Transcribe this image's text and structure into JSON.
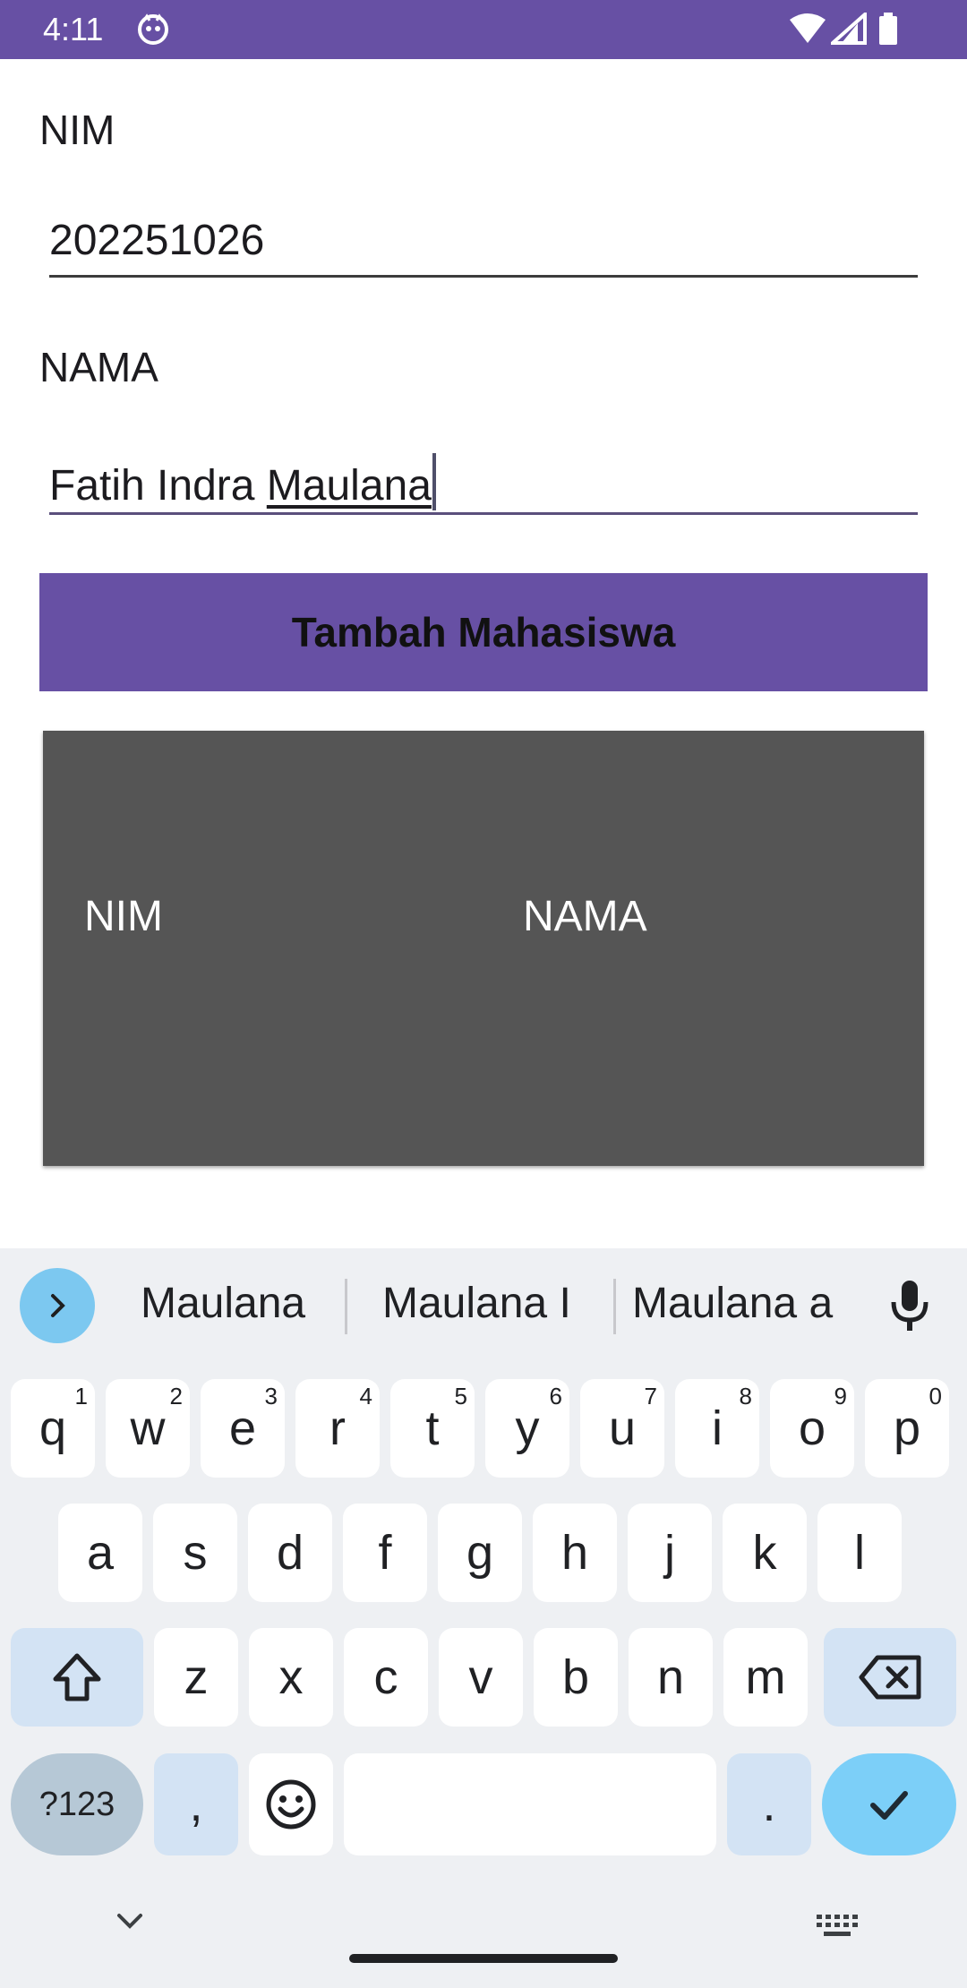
{
  "status_bar": {
    "time": "4:11"
  },
  "form": {
    "nim_label": "NIM",
    "nim_value": "202251026",
    "nama_label": "NAMA",
    "nama_value_prefix": "Fatih Indra ",
    "nama_value_composing": "Maulana",
    "add_button_label": "Tambah Mahasiswa"
  },
  "table": {
    "headers": [
      "NIM",
      "NAMA"
    ]
  },
  "keyboard": {
    "suggestions": [
      "Maulana",
      "Maulana I",
      "Maulana a"
    ],
    "row1": [
      {
        "key": "q",
        "hint": "1"
      },
      {
        "key": "w",
        "hint": "2"
      },
      {
        "key": "e",
        "hint": "3"
      },
      {
        "key": "r",
        "hint": "4"
      },
      {
        "key": "t",
        "hint": "5"
      },
      {
        "key": "y",
        "hint": "6"
      },
      {
        "key": "u",
        "hint": "7"
      },
      {
        "key": "i",
        "hint": "8"
      },
      {
        "key": "o",
        "hint": "9"
      },
      {
        "key": "p",
        "hint": "0"
      }
    ],
    "row2": [
      "a",
      "s",
      "d",
      "f",
      "g",
      "h",
      "j",
      "k",
      "l"
    ],
    "row3": [
      "z",
      "x",
      "c",
      "v",
      "b",
      "n",
      "m"
    ],
    "symbols_label": "?123",
    "comma_label": ",",
    "period_label": ".",
    "icons": {
      "expand": "chevron-right-icon",
      "mic": "microphone-icon",
      "shift": "shift-icon",
      "backspace": "backspace-icon",
      "emoji": "emoji-icon",
      "enter": "checkmark-icon",
      "hide": "chevron-down-icon",
      "switch": "keyboard-icon"
    }
  },
  "colors": {
    "primary": "#6750a4",
    "table_bg": "#555555",
    "keyboard_bg": "#eef0f3",
    "key_special": "#d3e3f4",
    "enter_key": "#7ccff8"
  }
}
